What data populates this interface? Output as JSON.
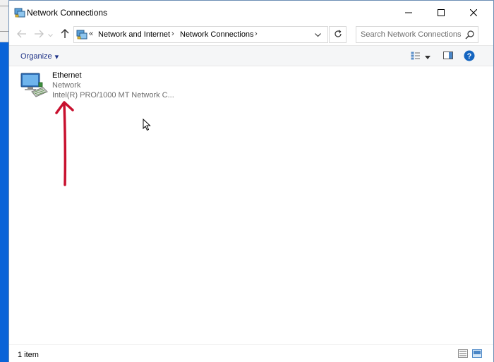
{
  "window": {
    "title": "Network Connections",
    "title_icon": "network-connections-icon"
  },
  "navigation": {
    "back_icon": "arrow-left-icon",
    "forward_icon": "arrow-right-icon",
    "recent_icon": "chevron-down-icon",
    "up_icon": "arrow-up-icon"
  },
  "address_bar": {
    "overflow": "«",
    "breadcrumbs": [
      "Network and Internet",
      "Network Connections"
    ],
    "separator": "›",
    "dropdown_icon": "chevron-down-icon",
    "refresh_icon": "refresh-icon"
  },
  "search": {
    "placeholder": "Search Network Connections",
    "icon": "search-icon"
  },
  "command_bar": {
    "organize_label": "Organize",
    "organize_caret": "▾",
    "icons": [
      "change-view-icon",
      "chevron-down-icon",
      "preview-pane-icon",
      "help-icon"
    ]
  },
  "items": [
    {
      "name": "Ethernet",
      "status": "Network",
      "device": "Intel(R) PRO/1000 MT Network C...",
      "icon": "ethernet-adapter-icon"
    }
  ],
  "annotation": {
    "arrow_color": "#c8102e"
  },
  "status_bar": {
    "item_count": "1 item",
    "view_icons": [
      "details-view-icon",
      "large-icons-view-icon"
    ]
  },
  "colors": {
    "desktop": "#0a64d8",
    "link_blue": "#1e3287",
    "help_blue": "#1565c0"
  }
}
